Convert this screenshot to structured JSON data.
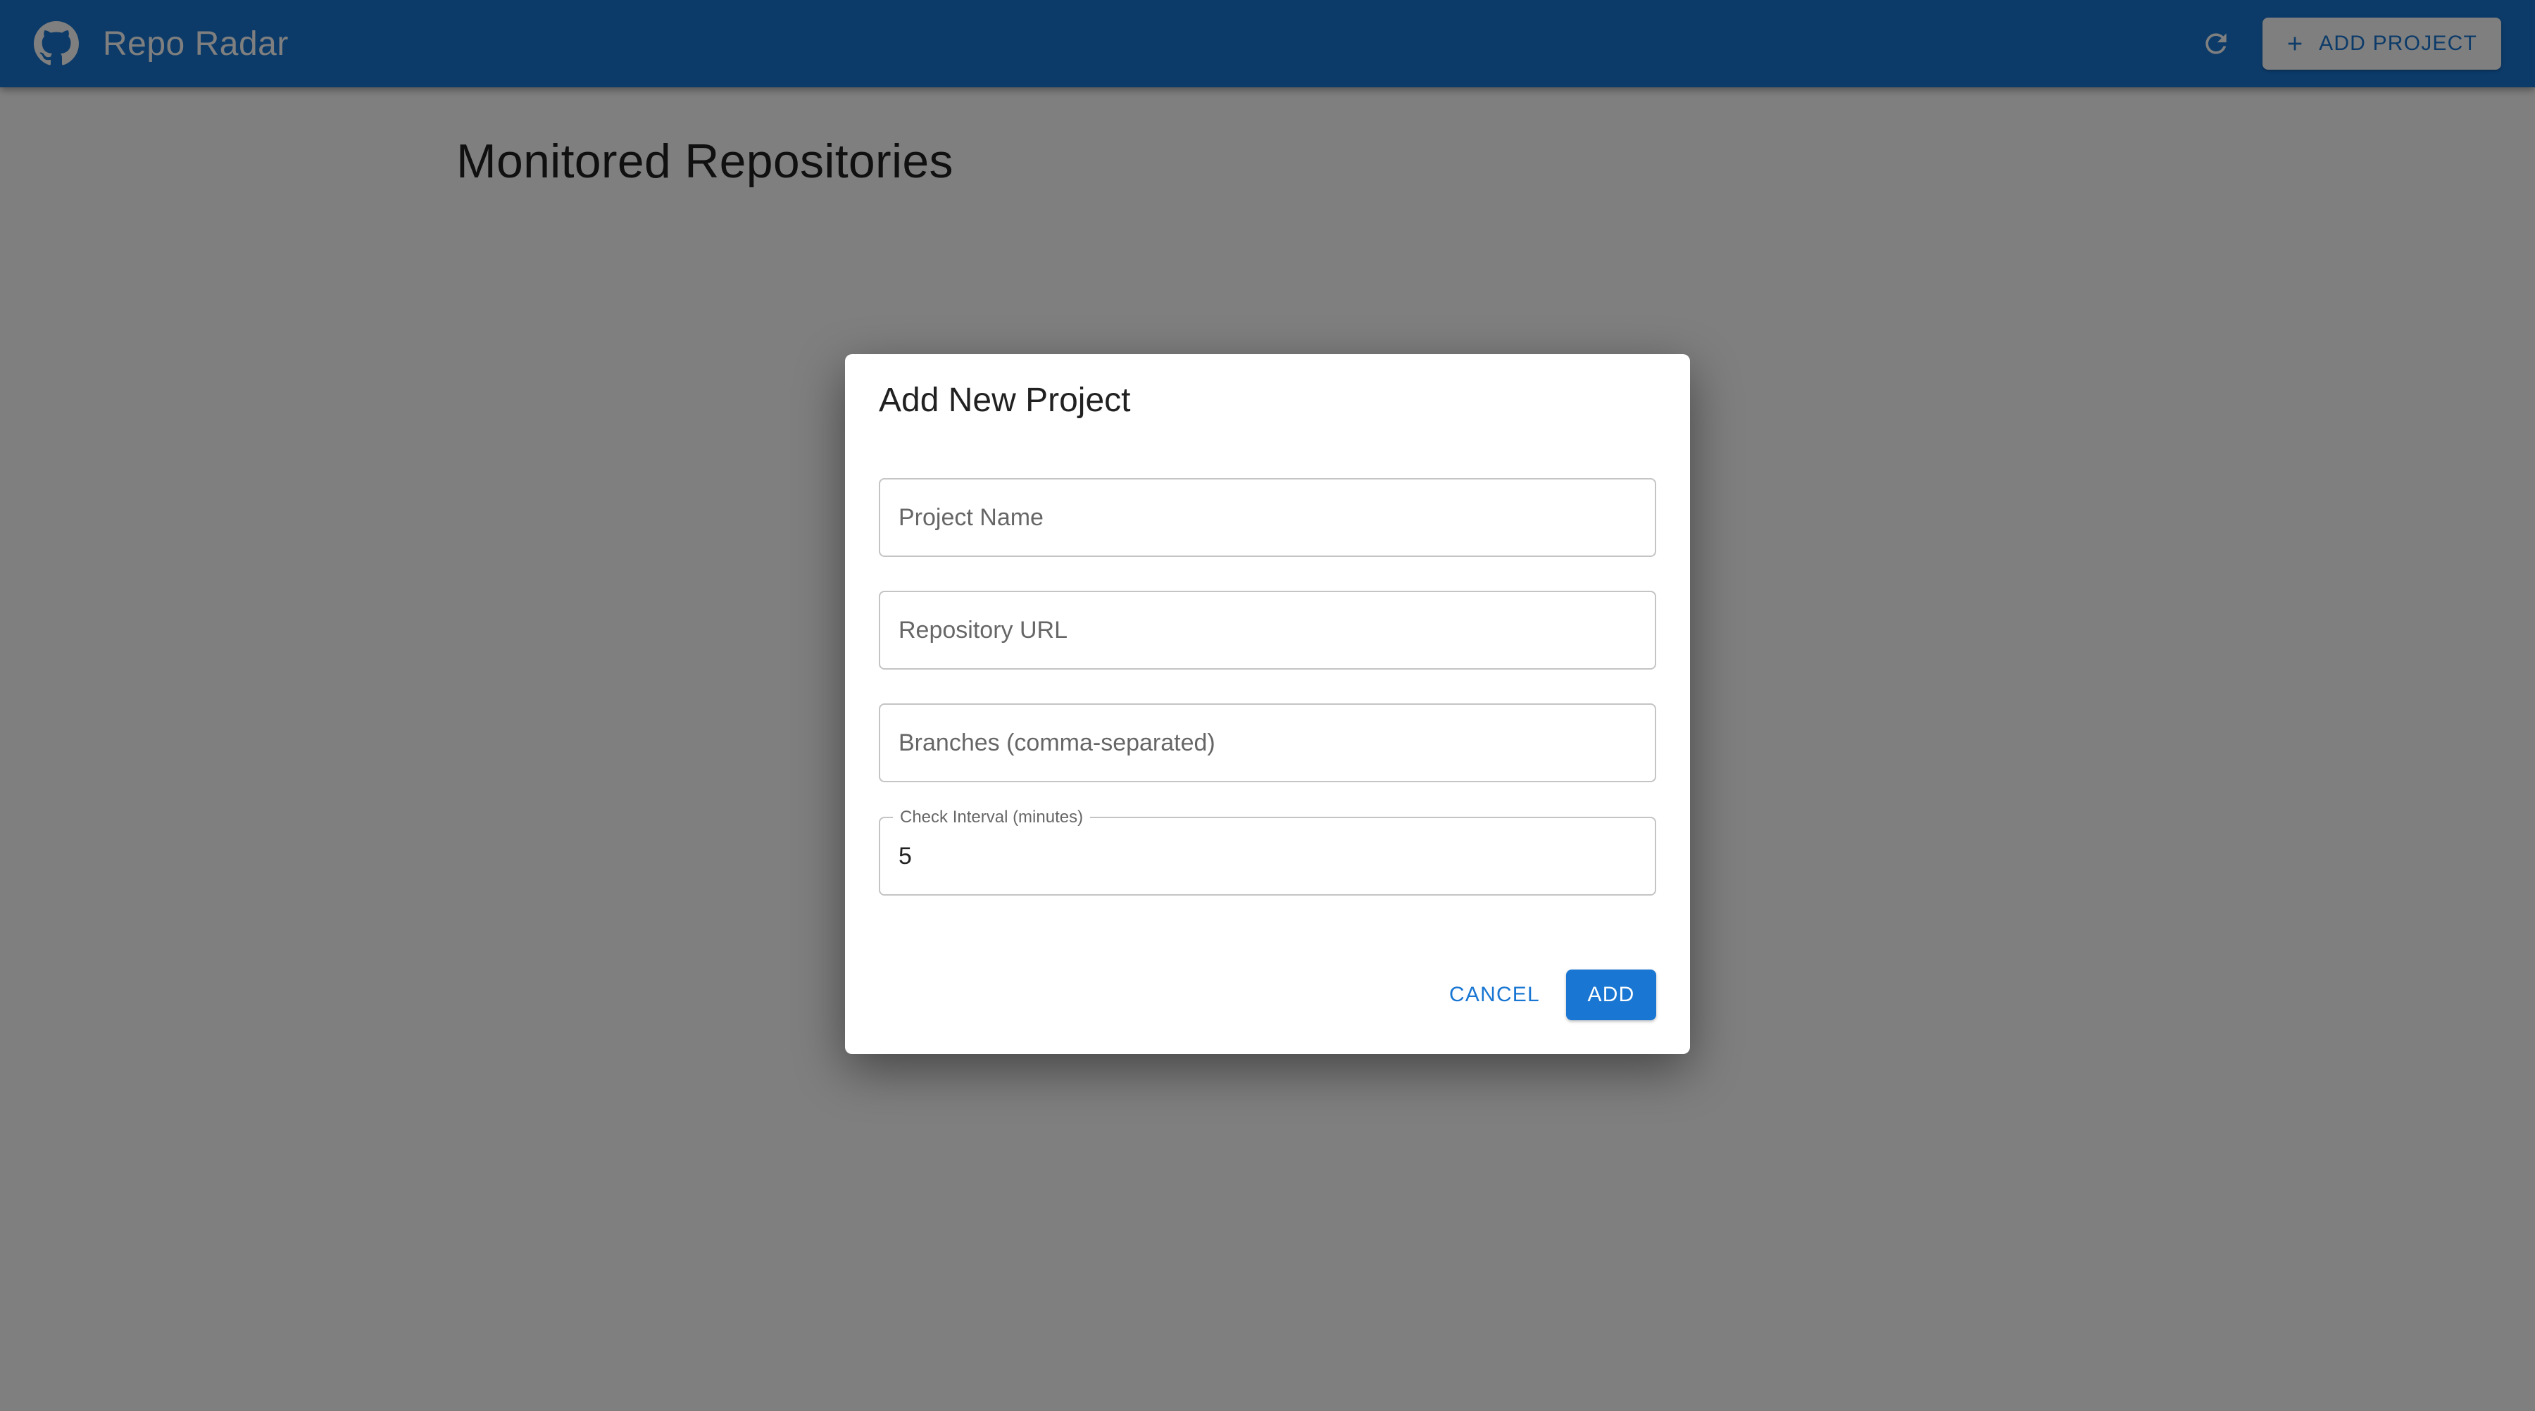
{
  "app": {
    "title": "Repo Radar",
    "logo_icon": "github-icon",
    "accent_color": "#1976d2"
  },
  "toolbar": {
    "refresh_icon": "refresh-icon",
    "add_project_label": "ADD PROJECT",
    "add_project_icon": "plus-icon"
  },
  "page": {
    "title": "Monitored Repositories"
  },
  "dialog": {
    "title": "Add New Project",
    "fields": {
      "project_name": {
        "placeholder": "Project Name",
        "value": ""
      },
      "repository_url": {
        "placeholder": "Repository URL",
        "value": ""
      },
      "branches": {
        "placeholder": "Branches (comma-separated)",
        "value": ""
      },
      "check_interval": {
        "label": "Check Interval (minutes)",
        "value": "5"
      }
    },
    "cancel_label": "CANCEL",
    "add_label": "ADD"
  }
}
